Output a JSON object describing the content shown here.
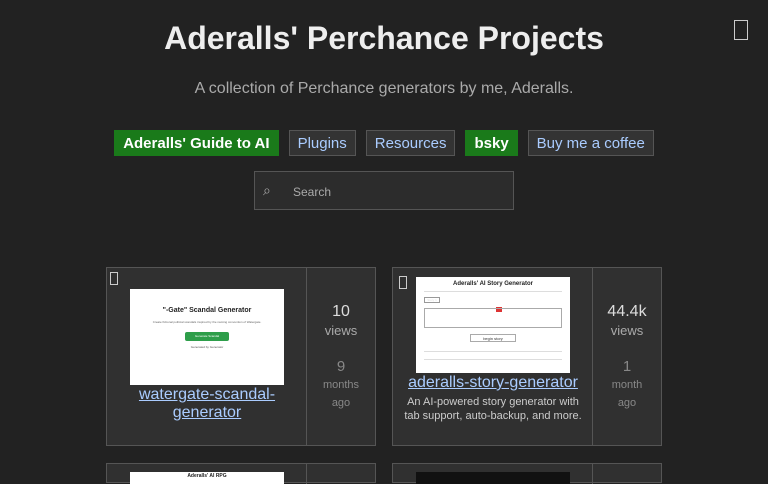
{
  "header": {
    "title": "Aderalls' Perchance Projects",
    "subtitle": "A collection of Perchance generators by me, Aderalls."
  },
  "nav": [
    {
      "label": "Aderalls' Guide to AI",
      "style": "green"
    },
    {
      "label": "Plugins",
      "style": "plain"
    },
    {
      "label": "Resources",
      "style": "plain"
    },
    {
      "label": "bsky",
      "style": "green"
    },
    {
      "label": "Buy me a coffee",
      "style": "plain"
    }
  ],
  "search": {
    "placeholder": "Search",
    "icon": "search-icon"
  },
  "cards": [
    {
      "name": "watergate-scandal-generator",
      "description": "",
      "views": "10",
      "views_label": "views",
      "age_num": "9",
      "age_unit": "months",
      "age_ago": "ago",
      "thumbnail": {
        "title": "\"-Gate\" Scandal Generator",
        "subtitle": "Create fictional political scandals inspired by the naming convention of Watergate.",
        "button": "Generate Scandal",
        "footer": "Generated by Generator"
      }
    },
    {
      "name": "aderalls-story-generator",
      "description": "An AI-powered story generator with tab support, auto-backup, and more.",
      "views": "44.4k",
      "views_label": "views",
      "age_num": "1",
      "age_unit": "month",
      "age_ago": "ago",
      "thumbnail": {
        "title": "Aderalls' AI Story Generator",
        "tab": "Story 1",
        "button": "begin story"
      }
    }
  ],
  "bottom_cards": [
    {
      "thumbnail_title": "Aderalls' AI RPG"
    }
  ],
  "colors": {
    "background": "#222222",
    "card": "#303030",
    "green": "#1a7a1a",
    "link": "#aaccff"
  }
}
